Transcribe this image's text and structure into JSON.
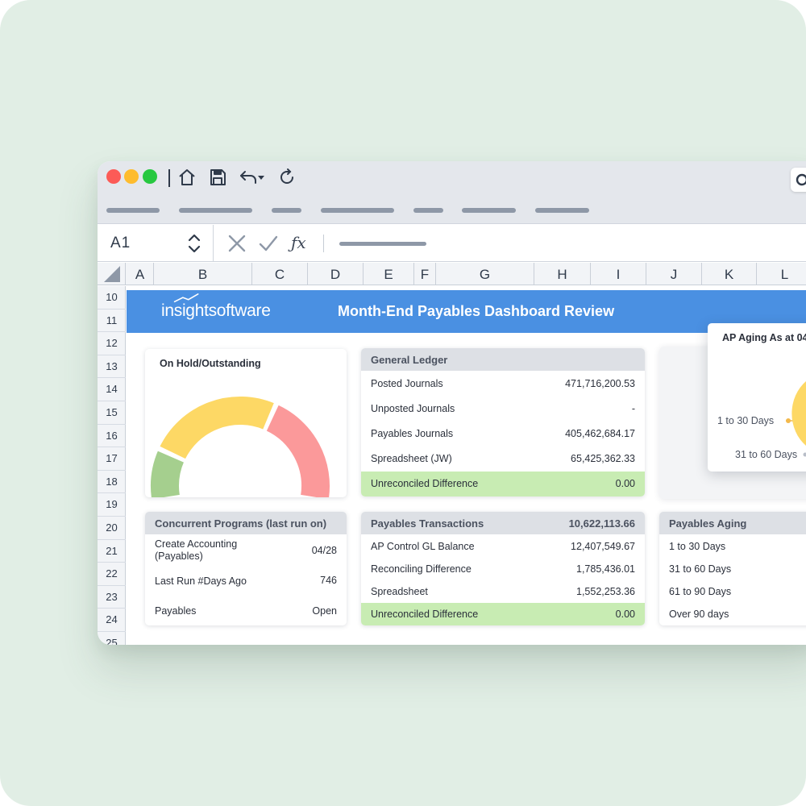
{
  "window": {
    "toolbar_icons": [
      "home-icon",
      "save-icon",
      "undo-icon",
      "dropdown-caret-icon",
      "redo-icon"
    ],
    "namebox": "A1",
    "formula_icons": [
      "cancel-icon",
      "confirm-icon",
      "function-icon"
    ],
    "fx_label": "ƒx"
  },
  "columns": [
    "A",
    "B",
    "C",
    "D",
    "E",
    "F",
    "G",
    "H",
    "I",
    "J",
    "K",
    "L"
  ],
  "rows": [
    "10",
    "11",
    "12",
    "13",
    "14",
    "15",
    "16",
    "17",
    "18",
    "19",
    "20",
    "21",
    "22",
    "23",
    "24",
    "25"
  ],
  "banner": {
    "logo": "insightsoftware",
    "title": "Month-End Payables Dashboard Review"
  },
  "on_hold": {
    "title": "On Hold/Outstanding",
    "chart_data": {
      "type": "pie",
      "style": "half-donut gauge",
      "segments": [
        {
          "color": "#a5cf8e",
          "share": 0.17
        },
        {
          "color": "#fdd865",
          "share": 0.45
        },
        {
          "color": "#fb999a",
          "share": 0.38
        }
      ]
    }
  },
  "general_ledger": {
    "title": "General Ledger",
    "rows": [
      {
        "label": "Posted Journals",
        "value": "471,716,200.53"
      },
      {
        "label": "Unposted Journals",
        "value": "-"
      },
      {
        "label": "Payables Journals",
        "value": "405,462,684.17"
      },
      {
        "label": "Spreadsheet (JW)",
        "value": "65,425,362.33"
      }
    ],
    "total": {
      "label": "Unreconciled Difference",
      "value": "0.00"
    }
  },
  "ap_aging_chart": {
    "title": "AP Aging As at 04",
    "labels": [
      "1 to 30 Days",
      "31 to 60 Days"
    ]
  },
  "concurrent": {
    "title": "Concurrent Programs (last run on)",
    "rows": [
      {
        "label": "Create Accounting (Payables)",
        "value": "04/28"
      },
      {
        "label": "Last Run #Days Ago",
        "value": "746"
      },
      {
        "label": "Payables",
        "value": "Open"
      }
    ]
  },
  "payables_transactions": {
    "title": "Payables Transactions",
    "header_value": "10,622,113.66",
    "rows": [
      {
        "label": "AP Control GL Balance",
        "value": "12,407,549.67"
      },
      {
        "label": "Reconciling Difference",
        "value": "1,785,436.01"
      },
      {
        "label": "Spreadsheet",
        "value": "1,552,253.36"
      }
    ],
    "total": {
      "label": "Unreconciled Difference",
      "value": "0.00"
    }
  },
  "payables_aging": {
    "title": "Payables Aging",
    "rows": [
      "1 to 30 Days",
      "31 to 60 Days",
      "61 to 90 Days",
      "Over 90 days"
    ]
  },
  "colors": {
    "banner": "#4a90e2",
    "highlight": "#c8ecb3",
    "card_header": "#dde0e5",
    "background": "#e1eee5"
  }
}
